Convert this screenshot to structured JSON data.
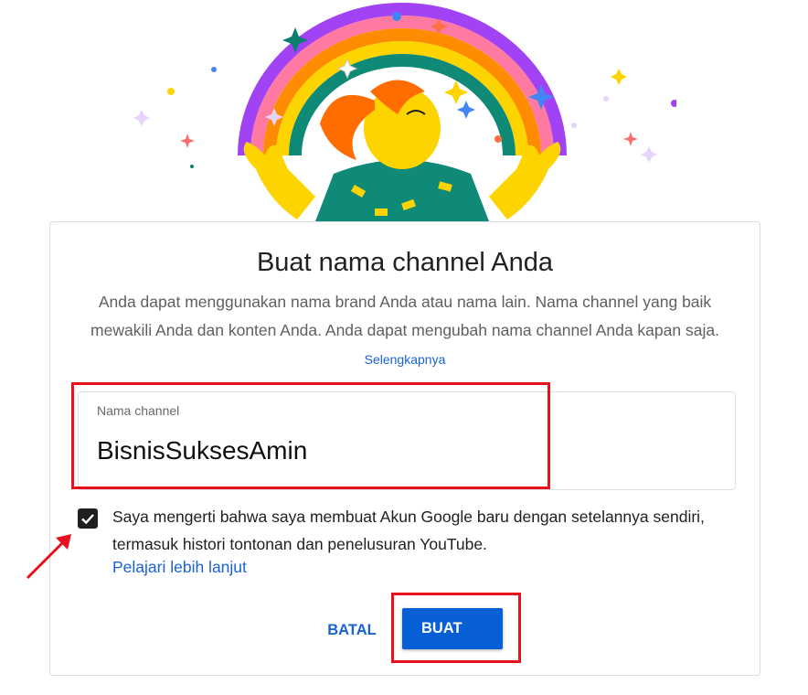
{
  "dialog": {
    "title": "Buat nama channel Anda",
    "description": "Anda dapat menggunakan nama brand Anda atau nama lain. Nama channel yang baik mewakili Anda dan konten Anda. Anda dapat mengubah nama channel Anda kapan saja.",
    "learn_more_inline": "Selengkapnya",
    "channel_field": {
      "label": "Nama channel",
      "value": "BisnisSuksesAmin"
    },
    "consent": {
      "checked": true,
      "text": "Saya mengerti bahwa saya membuat Akun Google baru dengan setelannya sendiri, termasuk histori tontonan dan penelusuran YouTube.",
      "link": "Pelajari lebih lanjut"
    },
    "buttons": {
      "cancel": "BATAL",
      "create": "BUAT"
    }
  },
  "colors": {
    "accent": "#065fd4",
    "link": "#1a63d4",
    "highlight": "#e8101a"
  },
  "icons": [
    "checkmark-icon",
    "annotation-arrow"
  ]
}
